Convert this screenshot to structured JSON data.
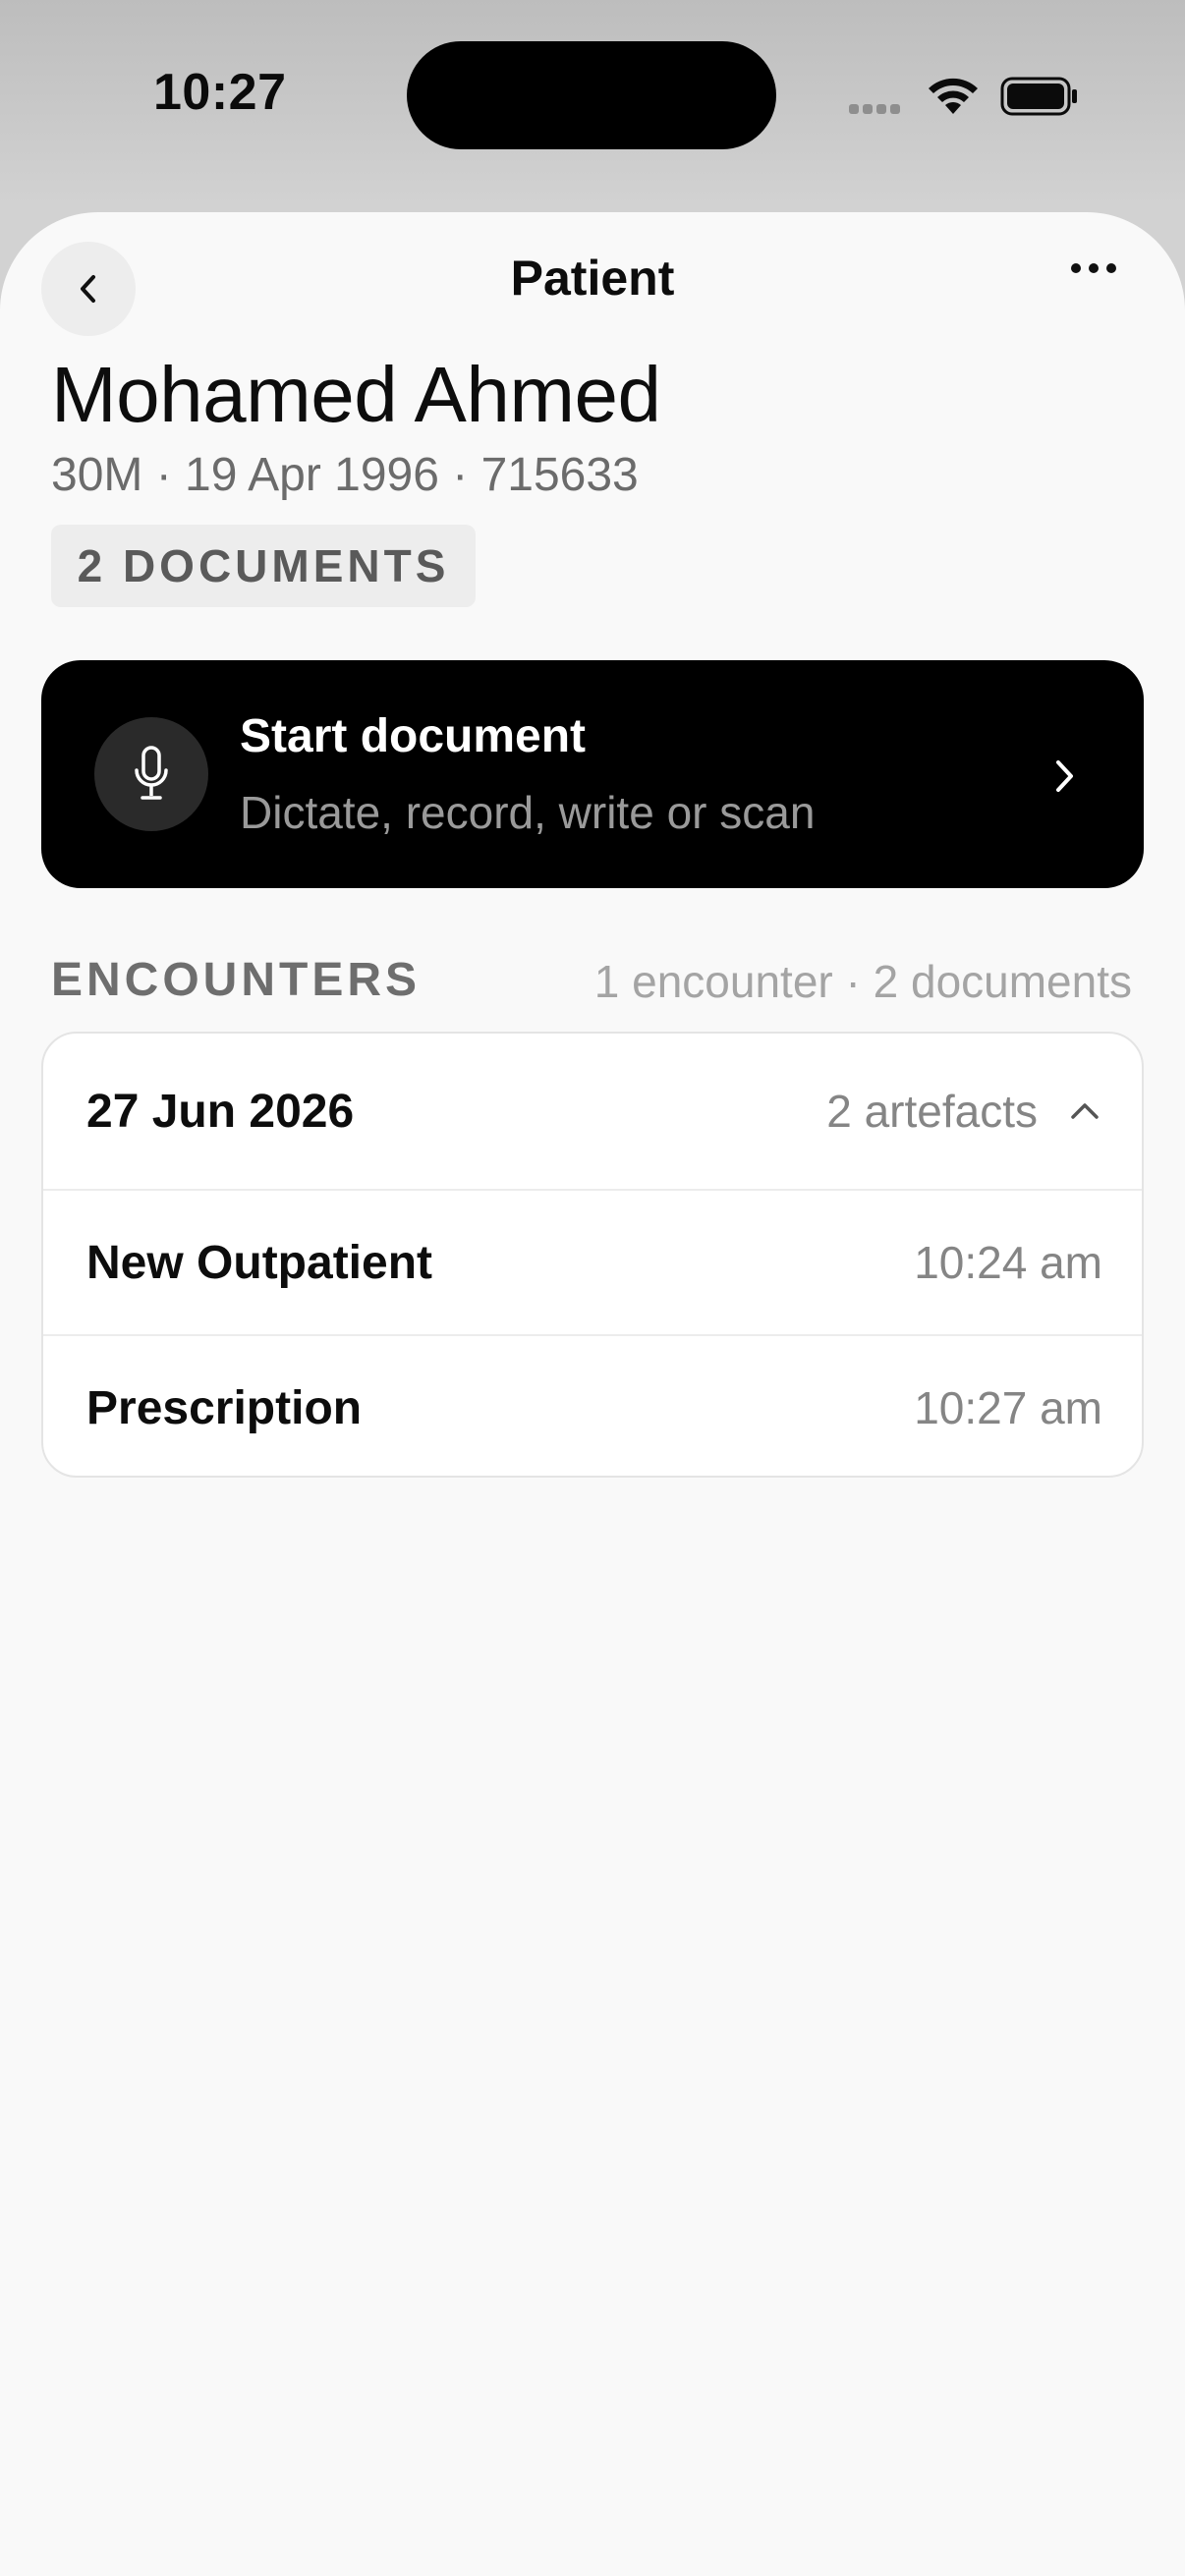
{
  "status_bar": {
    "time": "10:27"
  },
  "nav": {
    "title": "Patient",
    "back_icon": "chevron-left-icon",
    "more_icon": "ellipsis-icon"
  },
  "patient": {
    "name": "Mohamed Ahmed",
    "meta": "30M · 19 Apr 1996 · 715633",
    "documents_badge": "2 DOCUMENTS"
  },
  "start_document": {
    "title": "Start document",
    "subtitle": "Dictate, record, write or scan",
    "icon": "microphone-icon"
  },
  "encounters": {
    "header": "ENCOUNTERS",
    "summary": "1 encounter · 2 documents",
    "groups": [
      {
        "date": "27 Jun 2026",
        "artefacts_label": "2 artefacts",
        "expanded": true,
        "items": [
          {
            "name": "New Outpatient",
            "time": "10:24 am"
          },
          {
            "name": "Prescription",
            "time": "10:27 am"
          }
        ]
      }
    ]
  },
  "colors": {
    "sheet_background": "#f9f9f9",
    "card_dark": "#000000",
    "muted_text": "#858585"
  }
}
